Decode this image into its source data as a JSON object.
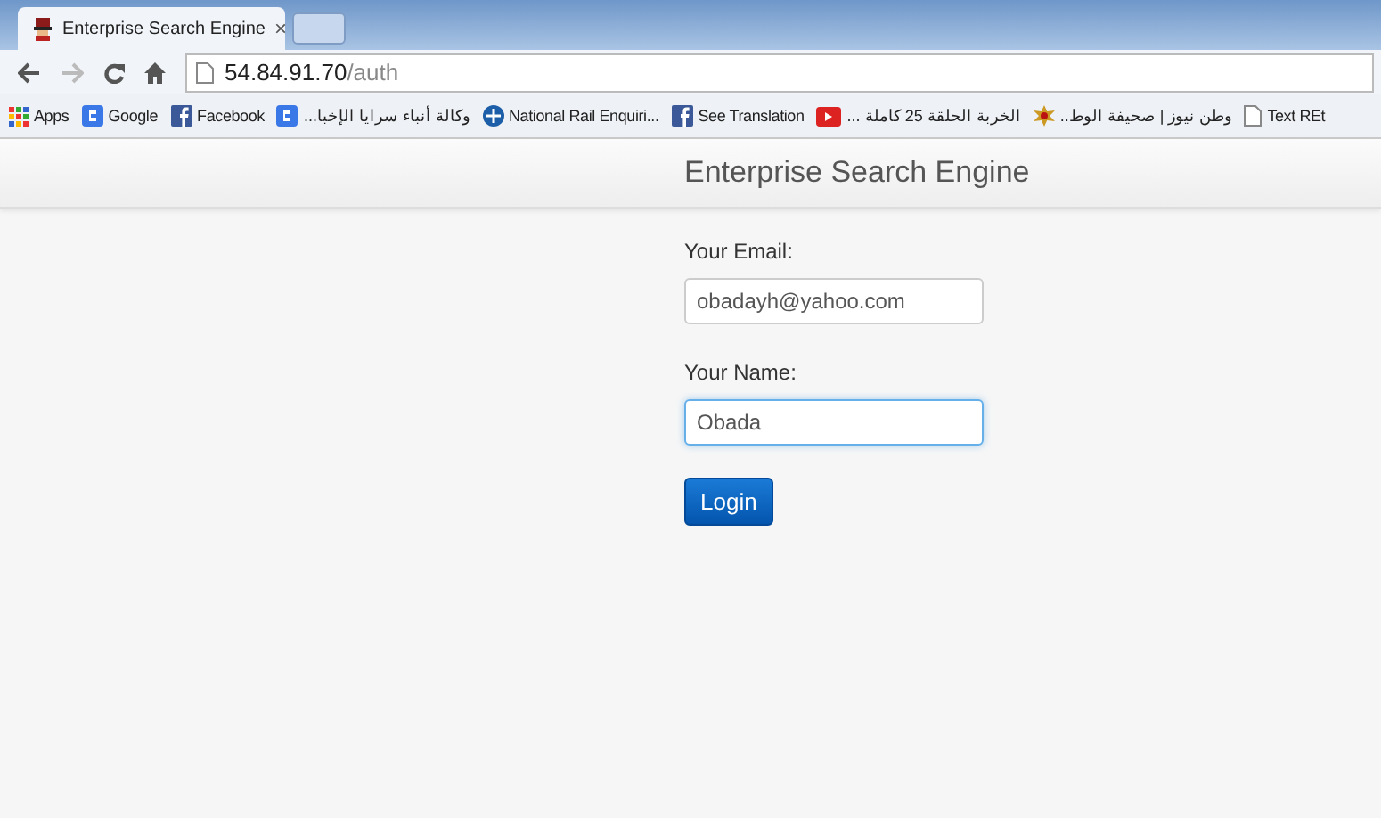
{
  "tab": {
    "title": "Enterprise Search Engine",
    "close": "×"
  },
  "address": {
    "host": "54.84.91.70",
    "path": "/auth"
  },
  "bookmarks": [
    {
      "kind": "apps",
      "label": "Apps"
    },
    {
      "kind": "google",
      "label": "Google"
    },
    {
      "kind": "facebook",
      "label": "Facebook"
    },
    {
      "kind": "google",
      "label": "وكالة أنباء سرايا الإخبا..."
    },
    {
      "kind": "globe",
      "label": "National Rail Enquiri..."
    },
    {
      "kind": "facebook",
      "label": "See Translation"
    },
    {
      "kind": "youtube",
      "label": "الخربة الحلقة 25 كاملة ..."
    },
    {
      "kind": "badge",
      "label": "وطن نيوز | صحيفة الوط.."
    },
    {
      "kind": "page",
      "label": "Text REt"
    }
  ],
  "page": {
    "title": "Enterprise Search Engine",
    "fields": [
      {
        "label": "Your Email:",
        "value": "obadayh@yahoo.com",
        "focused": false
      },
      {
        "label": "Your Name:",
        "value": "Obada",
        "focused": true
      }
    ],
    "button": "Login"
  }
}
